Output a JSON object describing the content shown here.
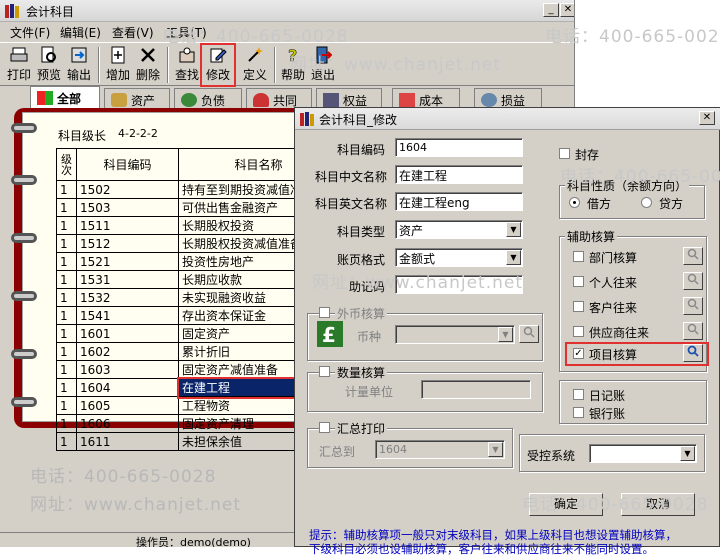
{
  "main": {
    "title": "会计科目",
    "menu": [
      "文件(F)",
      "编辑(E)",
      "查看(V)",
      "工具(T)"
    ],
    "toolbar": [
      "打印",
      "预览",
      "输出",
      "增加",
      "删除",
      "查找",
      "修改",
      "定义",
      "帮助",
      "退出"
    ],
    "tabs": [
      "全部",
      "资产",
      "负债",
      "共同",
      "权益",
      "成本",
      "损益"
    ],
    "level_label": "科目级长",
    "level_value": "4-2-2-2",
    "columns": [
      "级次",
      "科目编码",
      "科目名称"
    ],
    "rows": [
      {
        "lv": "1",
        "code": "1502",
        "name": "持有至到期投资减值准备"
      },
      {
        "lv": "1",
        "code": "1503",
        "name": "可供出售金融资产"
      },
      {
        "lv": "1",
        "code": "1511",
        "name": "长期股权投资"
      },
      {
        "lv": "1",
        "code": "1512",
        "name": "长期股权投资减值准备"
      },
      {
        "lv": "1",
        "code": "1521",
        "name": "投资性房地产"
      },
      {
        "lv": "1",
        "code": "1531",
        "name": "长期应收款"
      },
      {
        "lv": "1",
        "code": "1532",
        "name": "未实现融资收益"
      },
      {
        "lv": "1",
        "code": "1541",
        "name": "存出资本保证金"
      },
      {
        "lv": "1",
        "code": "1601",
        "name": "固定资产"
      },
      {
        "lv": "1",
        "code": "1602",
        "name": "累计折旧"
      },
      {
        "lv": "1",
        "code": "1603",
        "name": "固定资产减值准备"
      },
      {
        "lv": "1",
        "code": "1604",
        "name": "在建工程"
      },
      {
        "lv": "1",
        "code": "1605",
        "name": "工程物资"
      },
      {
        "lv": "1",
        "code": "1606",
        "name": "固定资产清理"
      },
      {
        "lv": "1",
        "code": "1611",
        "name": "未担保余值"
      }
    ],
    "status": "操作员：demo(demo)"
  },
  "dialog": {
    "title": "会计科目_修改",
    "code_label": "科目编码",
    "code_value": "1604",
    "cn_label": "科目中文名称",
    "cn_value": "在建工程",
    "en_label": "科目英文名称",
    "en_value": "在建工程eng",
    "type_label": "科目类型",
    "type_value": "资产",
    "format_label": "账页格式",
    "format_value": "金额式",
    "mnemonic_label": "助记码",
    "fc_label": "外币核算",
    "currency_label": "币种",
    "qty_label": "数量核算",
    "unit_label": "计量单位",
    "sum_label": "汇总打印",
    "sum_to_label": "汇总到",
    "sum_to_value": "1604",
    "seal_label": "封存",
    "nature_title": "科目性质（余额方向）",
    "debit": "借方",
    "credit": "贷方",
    "aux_title": "辅助核算",
    "aux": [
      "部门核算",
      "个人往来",
      "客户往来",
      "供应商往来",
      "项目核算"
    ],
    "journal": "日记账",
    "bank": "银行账",
    "control_label": "受控系统",
    "ok": "确定",
    "cancel": "取消",
    "tip1": "提示：辅助核算项一般只对末级科目，如果上级科目也想设置辅助核算，",
    "tip2": "下级科目必须也设辅助核算，客户往来和供应商往来不能同时设置。"
  },
  "watermark": {
    "phone": "电话：400-665-0028",
    "web": "网址：www.chanjet.net"
  }
}
